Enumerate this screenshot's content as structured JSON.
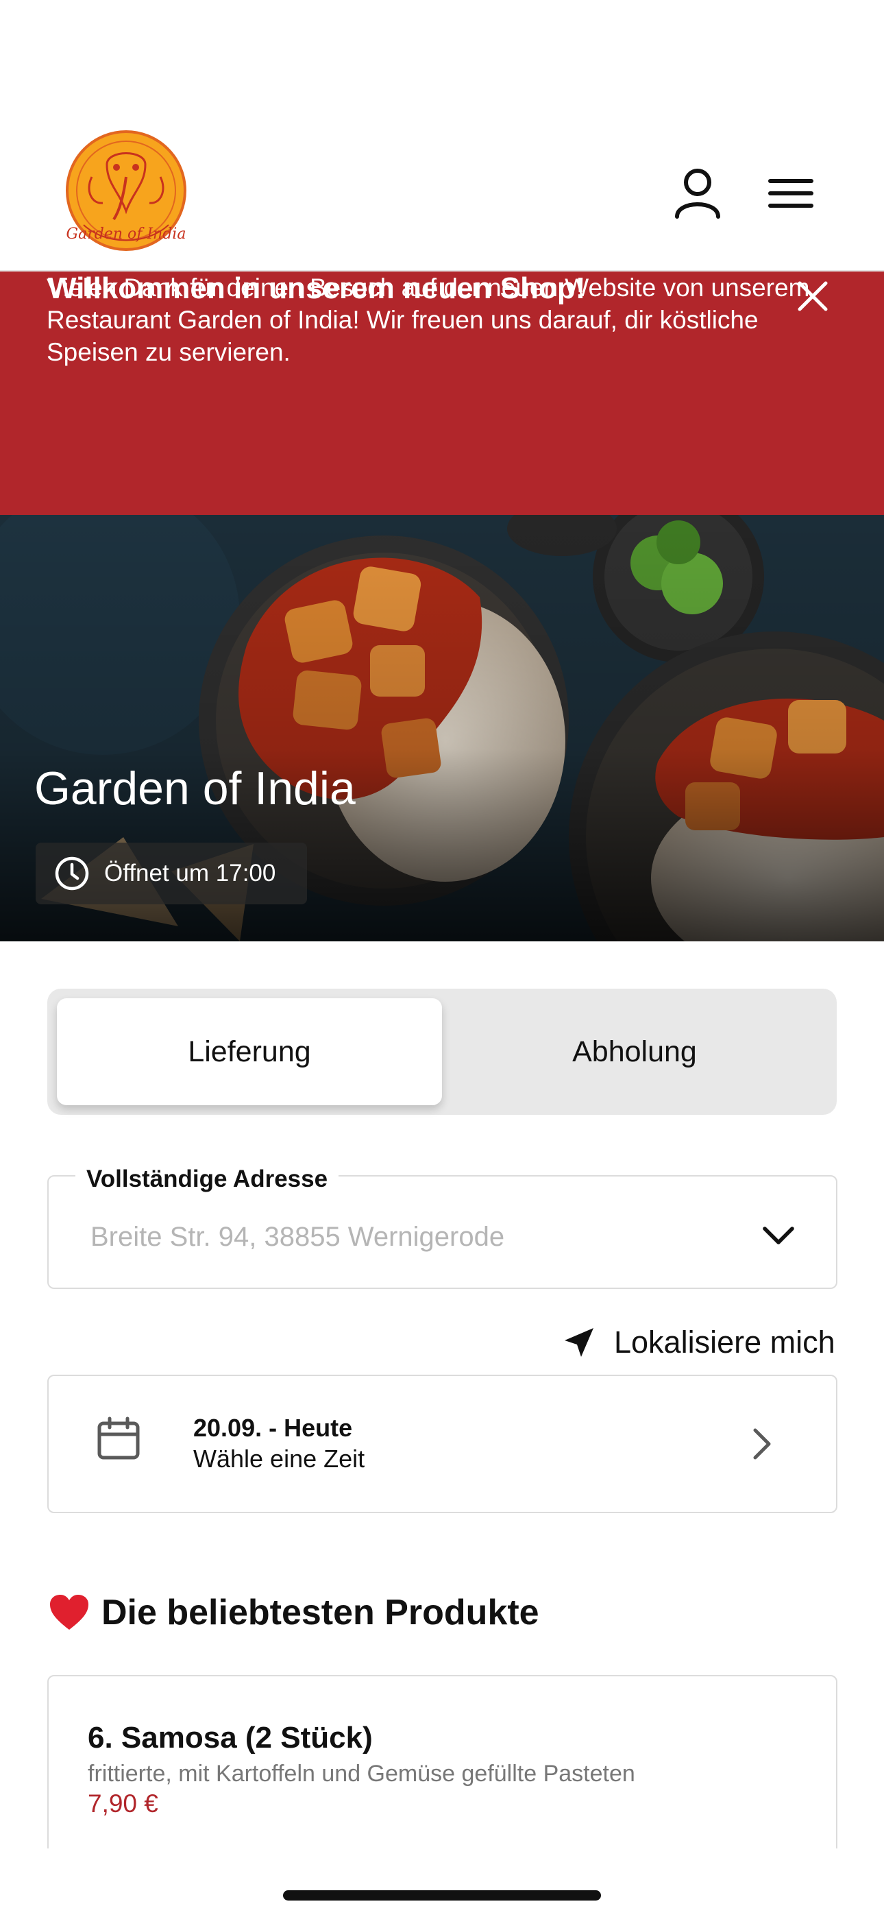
{
  "header": {
    "logo_text": "Garden of India",
    "user_icon": "user-icon",
    "menu_icon": "hamburger-menu-icon"
  },
  "banner": {
    "title": "Willkommen in unserem neuen Shop!",
    "text": "Vielen Dank für deinen Besuch auf der neuen Website von unserem Restaurant Garden of India! Wir freuen uns darauf, dir köstliche Speisen zu servieren.",
    "close_icon": "close-icon",
    "background_color": "#b1262b"
  },
  "hero": {
    "restaurant_name": "Garden of India",
    "opening_status": "Öffnet um 17:00",
    "clock_icon": "clock-icon"
  },
  "order_mode": {
    "options": [
      "Lieferung",
      "Abholung"
    ],
    "selected": "Lieferung"
  },
  "address": {
    "label": "Vollständige Adresse",
    "placeholder": "Breite Str. 94, 38855 Wernigerode",
    "chevron_icon": "chevron-down-icon"
  },
  "locate": {
    "label": "Lokalisiere mich",
    "icon": "location-arrow-icon"
  },
  "date_picker": {
    "date": "20.09. - Heute",
    "hint": "Wähle eine Zeit",
    "calendar_icon": "calendar-icon",
    "chevron_icon": "chevron-right-icon"
  },
  "popular": {
    "title": "Die beliebtesten Produkte",
    "heart_icon": "heart-icon",
    "products": [
      {
        "name": "6. Samosa (2 Stück)",
        "description": "frittierte, mit Kartoffeln und Gemüse gefüllte Pasteten",
        "price": "7,90 €"
      }
    ]
  },
  "colors": {
    "accent": "#b1262b",
    "logo_orange": "#f5a623"
  }
}
